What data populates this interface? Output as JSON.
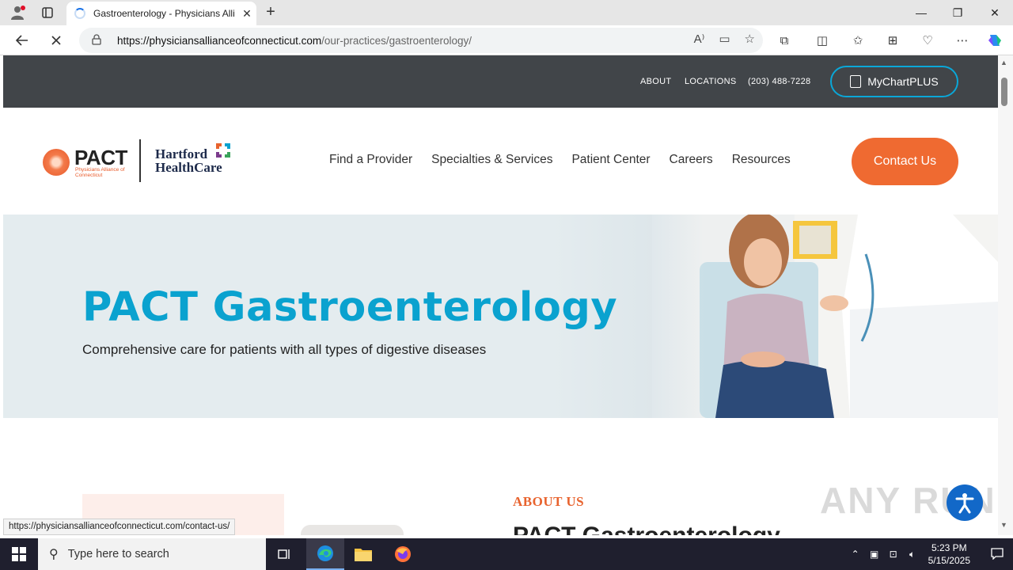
{
  "browser": {
    "tab_title": "Gastroenterology - Physicians Alli",
    "url_host": "https://physiciansallianceofconnecticut.com",
    "url_path": "/our-practices/gastroenterology/"
  },
  "utility": {
    "about": "ABOUT",
    "locations": "LOCATIONS",
    "phone": "(203) 488-7228",
    "mychart": "MyChartPLUS"
  },
  "logo": {
    "pact": "PACT",
    "pact_sub": "Physicians Alliance of Connecticut",
    "hhc": "Hartford HealthCare"
  },
  "nav": {
    "items": [
      "Find a Provider",
      "Specialties & Services",
      "Patient Center",
      "Careers",
      "Resources"
    ],
    "contact": "Contact Us"
  },
  "hero": {
    "title": "PACT Gastroenterology",
    "subtitle": "Comprehensive care for patients with all types of digestive diseases"
  },
  "about": {
    "label": "ABOUT US",
    "heading": "PACT Gastroenterology"
  },
  "status_url": "https://physiciansallianceofconnecticut.com/contact-us/",
  "watermark": "ANY RUN",
  "taskbar": {
    "search_placeholder": "Type here to search",
    "time": "5:23 PM",
    "date": "5/15/2025"
  },
  "colors": {
    "accent_orange": "#ef6a31",
    "accent_blue": "#0aa2cf",
    "utility_bg": "#414549"
  }
}
